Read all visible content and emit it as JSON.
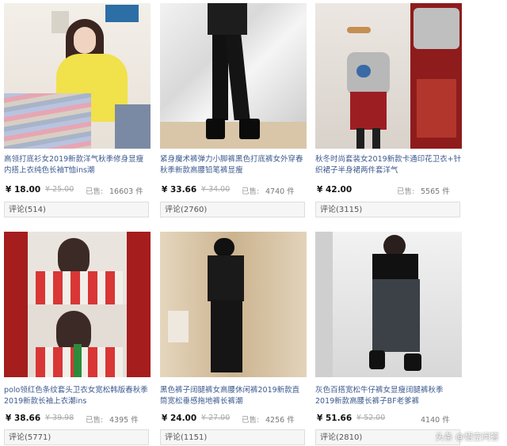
{
  "products": [
    {
      "title": "高领打底衫女2019新款洋气秋季修身显瘦内搭上衣纯色长袖T恤ins潮",
      "price": "¥ 18.00",
      "orig": "¥ 25.00",
      "sold_label": "已售:",
      "sold": "16603 件",
      "review": "评论(514)"
    },
    {
      "title": "紧身魔术裤弹力小脚裤黑色打底裤女外穿春秋季新款高腰铅笔裤显瘦",
      "price": "¥ 33.66",
      "orig": "¥ 34.00",
      "sold_label": "已售:",
      "sold": "4740 件",
      "review": "评论(2760)"
    },
    {
      "title": "秋冬时尚套装女2019新款卡通印花卫衣+针织裙子半身裙两件套洋气",
      "price": "¥ 42.00",
      "orig": "",
      "sold_label": "已售:",
      "sold": "5565 件",
      "review": "评论(3115)"
    },
    {
      "title": "polo领红色条纹套头卫衣女宽松韩版春秋季2019新款长袖上衣潮ins",
      "price": "¥ 38.66",
      "orig": "¥ 39.98",
      "sold_label": "已售:",
      "sold": "4395 件",
      "review": "评论(5771)"
    },
    {
      "title": "黑色裤子阔腿裤女高腰休闲裤2019新款直筒宽松垂感拖地裤长裤潮",
      "price": "¥ 24.00",
      "orig": "¥ 27.00",
      "sold_label": "已售:",
      "sold": "4256 件",
      "review": "评论(1151)"
    },
    {
      "title": "灰色百搭宽松牛仔裤女显瘦阔腿裤秋季2019新款高腰长裤子BF老爹裤",
      "price": "¥ 51.66",
      "orig": "¥ 52.00",
      "sold_label": "",
      "sold": "4140 件",
      "review": "评论(2810)"
    }
  ],
  "watermark": "头条 @悟空问答"
}
